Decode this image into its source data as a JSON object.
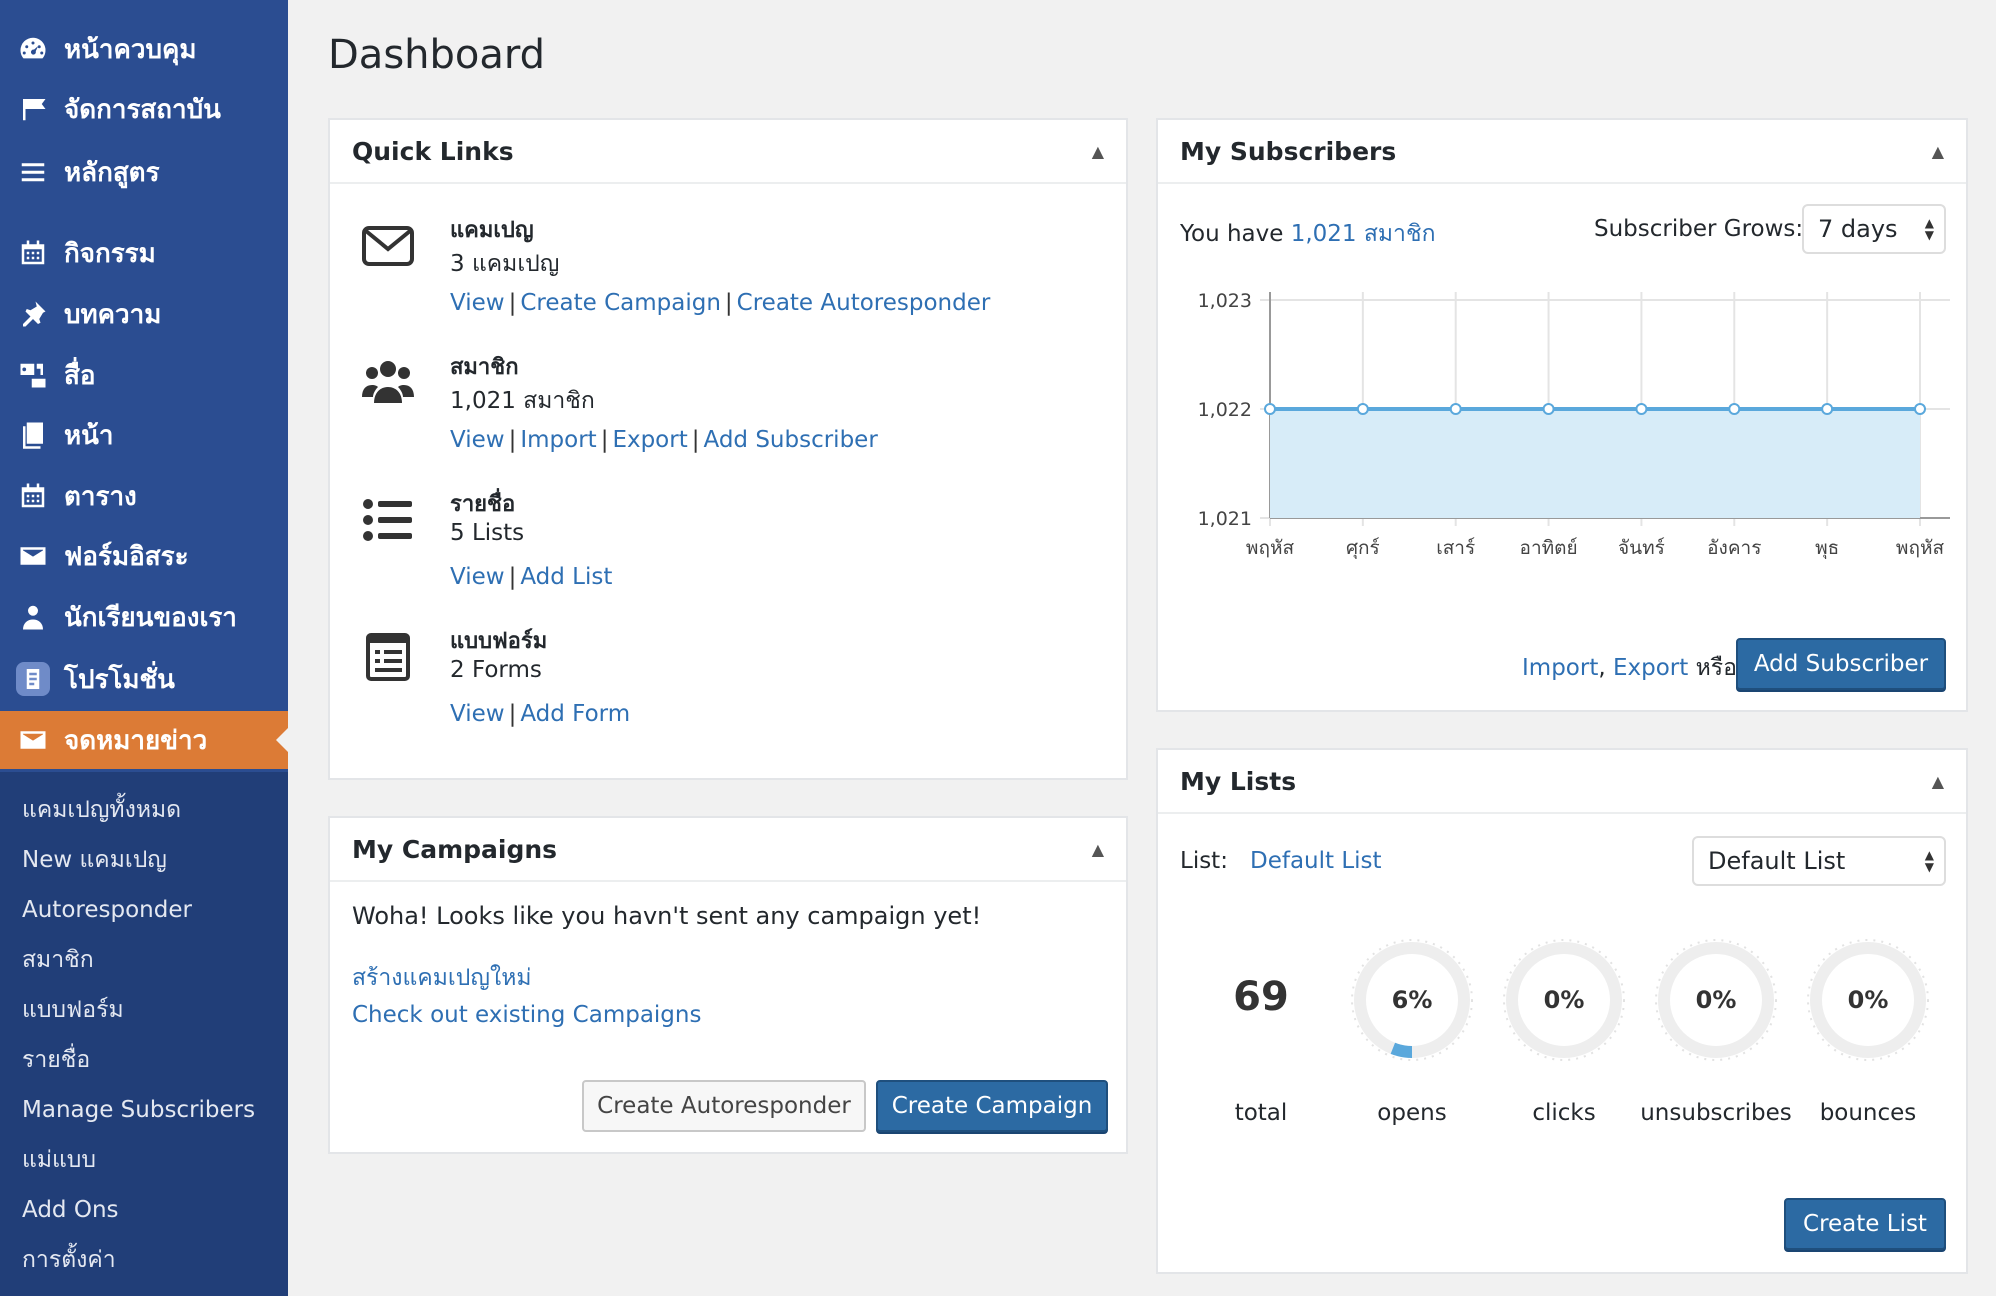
{
  "sidebar": {
    "items": [
      {
        "label": "หน้าควบคุม",
        "icon": "dashboard-icon"
      },
      {
        "label": "จัดการสถาบัน",
        "icon": "graduation-cap-icon"
      },
      {
        "label": "หลักสูตร",
        "icon": "list-icon"
      },
      {
        "label": "กิจกรรม",
        "icon": "calendar-icon"
      },
      {
        "label": "บทความ",
        "icon": "pin-icon"
      },
      {
        "label": "สื่อ",
        "icon": "media-icon"
      },
      {
        "label": "หน้า",
        "icon": "page-icon"
      },
      {
        "label": "ตาราง",
        "icon": "calendar-icon"
      },
      {
        "label": "ฟอร์มอิสระ",
        "icon": "mail-icon"
      },
      {
        "label": "นักเรียนของเรา",
        "icon": "user-icon"
      },
      {
        "label": "โปรโมชั่น",
        "icon": "promotion-icon"
      },
      {
        "label": "จดหมายข่าว",
        "icon": "mail-icon",
        "active": true
      }
    ],
    "submenu": [
      "แคมเปญทั้งหมด",
      "New แคมเปญ",
      "Autoresponder",
      "สมาชิก",
      "แบบฟอร์ม",
      "รายชื่อ",
      "Manage Subscribers",
      "แม่แบบ",
      "Add Ons",
      "การตั้งค่า"
    ]
  },
  "page_title": "Dashboard",
  "quick_links": {
    "title": "Quick Links",
    "rows": [
      {
        "title": "แคมเปญ",
        "count": "3 แคมเปญ",
        "links": [
          "View",
          "Create Campaign",
          "Create Autoresponder"
        ],
        "icon": "envelope-icon"
      },
      {
        "title": "สมาชิก",
        "count": "1,021 สมาชิก",
        "links": [
          "View",
          "Import",
          "Export",
          "Add Subscriber"
        ],
        "icon": "users-icon"
      },
      {
        "title": "รายชื่อ",
        "count": "5 Lists",
        "links": [
          "View",
          "Add List"
        ],
        "icon": "list-bullets-icon"
      },
      {
        "title": "แบบฟอร์ม",
        "count": "2 Forms",
        "links": [
          "View",
          "Add Form"
        ],
        "icon": "form-icon"
      }
    ]
  },
  "campaigns": {
    "title": "My Campaigns",
    "message": "Woha! Looks like you havn't sent any campaign yet!",
    "link_new": "สร้างแคมเปญใหม่",
    "link_existing": "Check out existing Campaigns",
    "btn_autoresponder": "Create Autoresponder",
    "btn_campaign": "Create Campaign"
  },
  "subscribers": {
    "title": "My Subscribers",
    "you_have": "You have",
    "count_link": "1,021 สมาชิก",
    "grows_label": "Subscriber Grows:",
    "grows_value": "7 days",
    "footer_import": "Import",
    "footer_comma": ",",
    "footer_export": "Export",
    "footer_or": "หรือ",
    "btn_add": "Add Subscriber"
  },
  "chart_data": {
    "type": "area",
    "categories": [
      "พฤหัส",
      "ศุกร์",
      "เสาร์",
      "อาทิตย์",
      "จันทร์",
      "อังคาร",
      "พุธ",
      "พฤหัส"
    ],
    "values": [
      1022,
      1022,
      1022,
      1022,
      1022,
      1022,
      1022,
      1022
    ],
    "y_ticks": [
      "1,023",
      "1,022",
      "1,021"
    ],
    "ylim": [
      1021,
      1023
    ],
    "grid": true,
    "color_line": "#5aa8dc",
    "color_fill": "#d7ecf8"
  },
  "lists": {
    "title": "My Lists",
    "list_label": "List:",
    "list_link": "Default List",
    "select_value": "Default List",
    "total_value": "69",
    "total_label": "total",
    "stats": [
      {
        "label": "opens",
        "text": "6%",
        "value": 6
      },
      {
        "label": "clicks",
        "text": "0%",
        "value": 0
      },
      {
        "label": "unsubscribes",
        "text": "0%",
        "value": 0
      },
      {
        "label": "bounces",
        "text": "0%",
        "value": 0
      }
    ],
    "btn_create": "Create List"
  },
  "colors": {
    "sidebar": "#2b4d91",
    "sidebar_active": "#dc7b36",
    "link": "#2e6fb3",
    "primary_button": "#2c6aa3"
  }
}
